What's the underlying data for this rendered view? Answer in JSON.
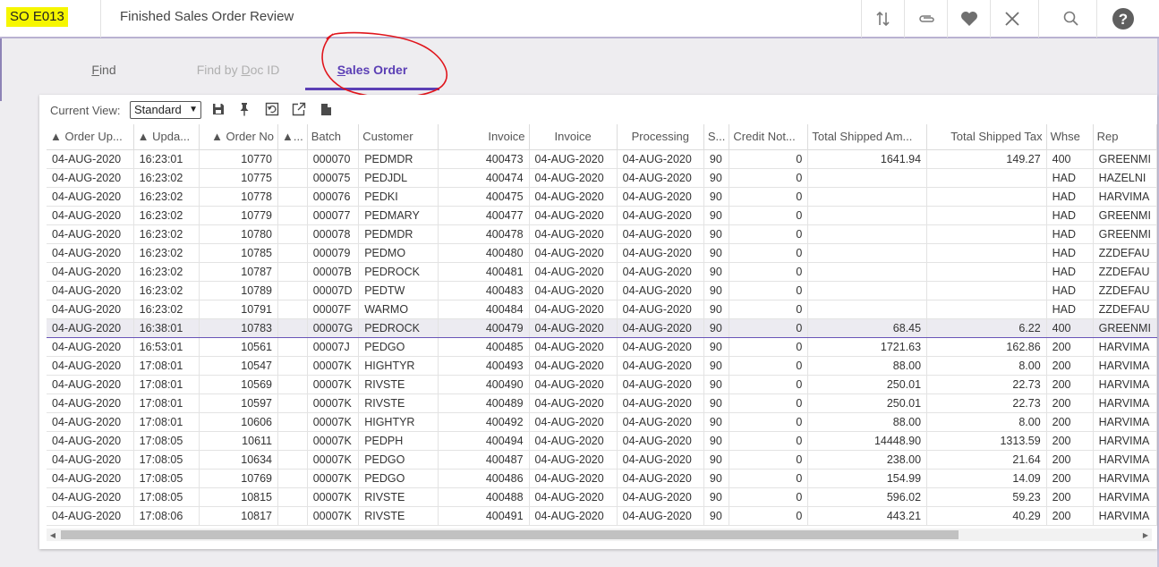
{
  "header": {
    "code": "SO E013",
    "title": "Finished Sales Order Review",
    "icons": [
      "sort-icon",
      "attachment-icon",
      "favorite-heart-icon",
      "close-icon",
      "search-icon",
      "help-icon"
    ]
  },
  "tabs": [
    {
      "label_pre": "",
      "label_u": "F",
      "label_post": "ind",
      "state": "normal"
    },
    {
      "label_pre": "Find by ",
      "label_u": "D",
      "label_post": "oc ID",
      "state": "disabled"
    },
    {
      "label_pre": "",
      "label_u": "S",
      "label_post": "ales Order",
      "state": "active"
    }
  ],
  "toolbar": {
    "current_view_label": "Current View:",
    "current_view_value": "Standard",
    "icons": [
      "save-icon",
      "pin-icon",
      "restore-icon",
      "export-icon",
      "document-icon"
    ]
  },
  "columns": [
    "▲ Order Up...",
    "▲ Upda...",
    "▲ Order No",
    "▲...",
    "Batch",
    "Customer",
    "Invoice",
    "Invoice",
    "Processing",
    "S...",
    "Credit Not...",
    "Total Shipped Am...",
    "Total Shipped Tax",
    "Whse",
    "Rep"
  ],
  "rows": [
    [
      "04-AUG-2020",
      "16:23:01",
      "10770",
      "",
      "000070",
      "PEDMDR",
      "400473",
      "04-AUG-2020",
      "04-AUG-2020",
      "90",
      "0",
      "1641.94",
      "149.27",
      "400",
      "GREENMI"
    ],
    [
      "04-AUG-2020",
      "16:23:02",
      "10775",
      "",
      "000075",
      "PEDJDL",
      "400474",
      "04-AUG-2020",
      "04-AUG-2020",
      "90",
      "0",
      "",
      "",
      "HAD",
      "HAZELNI"
    ],
    [
      "04-AUG-2020",
      "16:23:02",
      "10778",
      "",
      "000076",
      "PEDKI",
      "400475",
      "04-AUG-2020",
      "04-AUG-2020",
      "90",
      "0",
      "",
      "",
      "HAD",
      "HARVIMA"
    ],
    [
      "04-AUG-2020",
      "16:23:02",
      "10779",
      "",
      "000077",
      "PEDMARY",
      "400477",
      "04-AUG-2020",
      "04-AUG-2020",
      "90",
      "0",
      "",
      "",
      "HAD",
      "GREENMI"
    ],
    [
      "04-AUG-2020",
      "16:23:02",
      "10780",
      "",
      "000078",
      "PEDMDR",
      "400478",
      "04-AUG-2020",
      "04-AUG-2020",
      "90",
      "0",
      "",
      "",
      "HAD",
      "GREENMI"
    ],
    [
      "04-AUG-2020",
      "16:23:02",
      "10785",
      "",
      "000079",
      "PEDMO",
      "400480",
      "04-AUG-2020",
      "04-AUG-2020",
      "90",
      "0",
      "",
      "",
      "HAD",
      "ZZDEFAU"
    ],
    [
      "04-AUG-2020",
      "16:23:02",
      "10787",
      "",
      "00007B",
      "PEDROCK",
      "400481",
      "04-AUG-2020",
      "04-AUG-2020",
      "90",
      "0",
      "",
      "",
      "HAD",
      "ZZDEFAU"
    ],
    [
      "04-AUG-2020",
      "16:23:02",
      "10789",
      "",
      "00007D",
      "PEDTW",
      "400483",
      "04-AUG-2020",
      "04-AUG-2020",
      "90",
      "0",
      "",
      "",
      "HAD",
      "ZZDEFAU"
    ],
    [
      "04-AUG-2020",
      "16:23:02",
      "10791",
      "",
      "00007F",
      "WARMO",
      "400484",
      "04-AUG-2020",
      "04-AUG-2020",
      "90",
      "0",
      "",
      "",
      "HAD",
      "ZZDEFAU"
    ],
    [
      "04-AUG-2020",
      "16:38:01",
      "10783",
      "",
      "00007G",
      "PEDROCK",
      "400479",
      "04-AUG-2020",
      "04-AUG-2020",
      "90",
      "0",
      "68.45",
      "6.22",
      "400",
      "GREENMI"
    ],
    [
      "04-AUG-2020",
      "16:53:01",
      "10561",
      "",
      "00007J",
      "PEDGO",
      "400485",
      "04-AUG-2020",
      "04-AUG-2020",
      "90",
      "0",
      "1721.63",
      "162.86",
      "200",
      "HARVIMA"
    ],
    [
      "04-AUG-2020",
      "17:08:01",
      "10547",
      "",
      "00007K",
      "HIGHTYR",
      "400493",
      "04-AUG-2020",
      "04-AUG-2020",
      "90",
      "0",
      "88.00",
      "8.00",
      "200",
      "HARVIMA"
    ],
    [
      "04-AUG-2020",
      "17:08:01",
      "10569",
      "",
      "00007K",
      "RIVSTE",
      "400490",
      "04-AUG-2020",
      "04-AUG-2020",
      "90",
      "0",
      "250.01",
      "22.73",
      "200",
      "HARVIMA"
    ],
    [
      "04-AUG-2020",
      "17:08:01",
      "10597",
      "",
      "00007K",
      "RIVSTE",
      "400489",
      "04-AUG-2020",
      "04-AUG-2020",
      "90",
      "0",
      "250.01",
      "22.73",
      "200",
      "HARVIMA"
    ],
    [
      "04-AUG-2020",
      "17:08:01",
      "10606",
      "",
      "00007K",
      "HIGHTYR",
      "400492",
      "04-AUG-2020",
      "04-AUG-2020",
      "90",
      "0",
      "88.00",
      "8.00",
      "200",
      "HARVIMA"
    ],
    [
      "04-AUG-2020",
      "17:08:05",
      "10611",
      "",
      "00007K",
      "PEDPH",
      "400494",
      "04-AUG-2020",
      "04-AUG-2020",
      "90",
      "0",
      "14448.90",
      "1313.59",
      "200",
      "HARVIMA"
    ],
    [
      "04-AUG-2020",
      "17:08:05",
      "10634",
      "",
      "00007K",
      "PEDGO",
      "400487",
      "04-AUG-2020",
      "04-AUG-2020",
      "90",
      "0",
      "238.00",
      "21.64",
      "200",
      "HARVIMA"
    ],
    [
      "04-AUG-2020",
      "17:08:05",
      "10769",
      "",
      "00007K",
      "PEDGO",
      "400486",
      "04-AUG-2020",
      "04-AUG-2020",
      "90",
      "0",
      "154.99",
      "14.09",
      "200",
      "HARVIMA"
    ],
    [
      "04-AUG-2020",
      "17:08:05",
      "10815",
      "",
      "00007K",
      "RIVSTE",
      "400488",
      "04-AUG-2020",
      "04-AUG-2020",
      "90",
      "0",
      "596.02",
      "59.23",
      "200",
      "HARVIMA"
    ],
    [
      "04-AUG-2020",
      "17:08:06",
      "10817",
      "",
      "00007K",
      "RIVSTE",
      "400491",
      "04-AUG-2020",
      "04-AUG-2020",
      "90",
      "0",
      "443.21",
      "40.29",
      "200",
      "HARVIMA"
    ]
  ],
  "selected_row_index": 9,
  "colors": {
    "accent": "#5b3fb5",
    "highlight": "#f6f600",
    "annotation": "#e0151c",
    "selected_row": "#ecebf1"
  }
}
